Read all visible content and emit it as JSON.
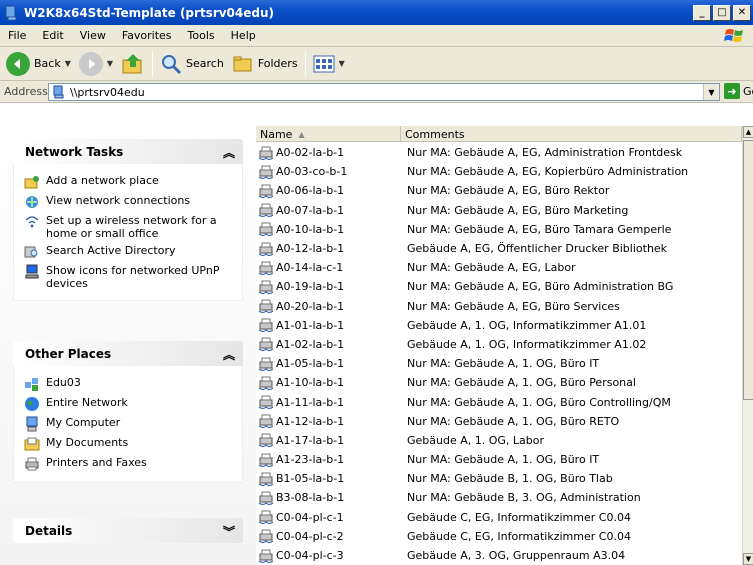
{
  "window": {
    "title": "W2K8x64Std-Template (prtsrv04edu)"
  },
  "menu": [
    "File",
    "Edit",
    "View",
    "Favorites",
    "Tools",
    "Help"
  ],
  "menu_keys": [
    "F",
    "E",
    "V",
    "a",
    "T",
    "H"
  ],
  "toolbar": {
    "back": "Back",
    "search": "Search",
    "folders": "Folders"
  },
  "address": {
    "label": "Address",
    "value": "\\\\prtsrv04edu",
    "go": "Go"
  },
  "network_tasks": {
    "title": "Network Tasks",
    "items": [
      "Add a network place",
      "View network connections",
      "Set up a wireless network for a home or small office",
      "Search Active Directory",
      "Show icons for networked UPnP devices"
    ]
  },
  "other_places": {
    "title": "Other Places",
    "items": [
      "Edu03",
      "Entire Network",
      "My Computer",
      "My Documents",
      "Printers and Faxes"
    ]
  },
  "details": {
    "title": "Details"
  },
  "list": {
    "columns": {
      "name": "Name",
      "comments": "Comments"
    },
    "rows": [
      {
        "name": "A0-02-la-b-1",
        "comment": "Nur MA: Gebäude A, EG, Administration Frontdesk"
      },
      {
        "name": "A0-03-co-b-1",
        "comment": "Nur MA: Gebäude A, EG, Kopierbüro Administration"
      },
      {
        "name": "A0-06-la-b-1",
        "comment": "Nur MA: Gebäude A, EG, Büro Rektor"
      },
      {
        "name": "A0-07-la-b-1",
        "comment": "Nur MA: Gebäude A, EG, Büro Marketing"
      },
      {
        "name": "A0-10-la-b-1",
        "comment": "Nur MA: Gebäude A, EG, Büro Tamara Gemperle"
      },
      {
        "name": "A0-12-la-b-1",
        "comment": "Gebäude A, EG, Öffentlicher Drucker Bibliothek"
      },
      {
        "name": "A0-14-la-c-1",
        "comment": "Nur MA: Gebäude A, EG, Labor"
      },
      {
        "name": "A0-19-la-b-1",
        "comment": "Nur MA: Gebäude A, EG, Büro Administration BG"
      },
      {
        "name": "A0-20-la-b-1",
        "comment": "Nur MA: Gebäude A, EG, Büro Services"
      },
      {
        "name": "A1-01-la-b-1",
        "comment": "Gebäude A, 1. OG, Informatikzimmer A1.01"
      },
      {
        "name": "A1-02-la-b-1",
        "comment": "Gebäude A, 1. OG, Informatikzimmer A1.02"
      },
      {
        "name": "A1-05-la-b-1",
        "comment": "Nur MA: Gebäude A, 1. OG, Büro IT"
      },
      {
        "name": "A1-10-la-b-1",
        "comment": "Nur MA: Gebäude A, 1. OG, Büro Personal"
      },
      {
        "name": "A1-11-la-b-1",
        "comment": "Nur MA: Gebäude A, 1. OG, Büro Controlling/QM"
      },
      {
        "name": "A1-12-la-b-1",
        "comment": "Nur MA: Gebäude A, 1. OG, Büro RETO"
      },
      {
        "name": "A1-17-la-b-1",
        "comment": "Gebäude A, 1. OG, Labor"
      },
      {
        "name": "A1-23-la-b-1",
        "comment": "Nur MA: Gebäude A, 1. OG, Büro IT"
      },
      {
        "name": "B1-05-la-b-1",
        "comment": "Nur MA: Gebäude B, 1. OG, Büro Tlab"
      },
      {
        "name": "B3-08-la-b-1",
        "comment": "Nur MA: Gebäude B, 3. OG, Administration"
      },
      {
        "name": "C0-04-pl-c-1",
        "comment": "Gebäude C, EG, Informatikzimmer C0.04"
      },
      {
        "name": "C0-04-pl-c-2",
        "comment": "Gebäude C, EG, Informatikzimmer C0.04"
      },
      {
        "name": "C0-04-pl-c-3",
        "comment": "Gebäude A, 3. OG, Gruppenraum A3.04"
      }
    ]
  }
}
